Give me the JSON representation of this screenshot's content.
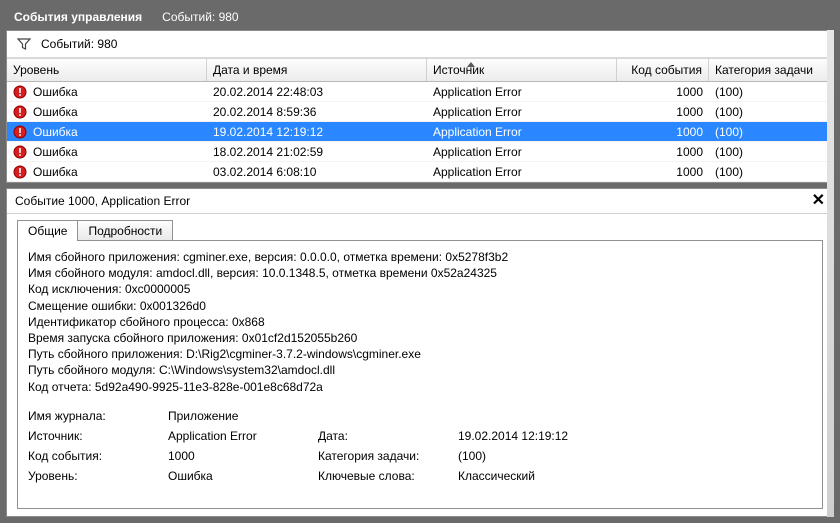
{
  "window": {
    "title": "События управления",
    "countLabel": "Событий: 980",
    "filterCount": "Событий: 980"
  },
  "columns": {
    "level": "Уровень",
    "datetime": "Дата и время",
    "source": "Источник",
    "code": "Код события",
    "category": "Категория задачи"
  },
  "rows": [
    {
      "level": "Ошибка",
      "dt": "20.02.2014 22:48:03",
      "src": "Application Error",
      "code": "1000",
      "cat": "(100)",
      "selected": false
    },
    {
      "level": "Ошибка",
      "dt": "20.02.2014 8:59:36",
      "src": "Application Error",
      "code": "1000",
      "cat": "(100)",
      "selected": false
    },
    {
      "level": "Ошибка",
      "dt": "19.02.2014 12:19:12",
      "src": "Application Error",
      "code": "1000",
      "cat": "(100)",
      "selected": true
    },
    {
      "level": "Ошибка",
      "dt": "18.02.2014 21:02:59",
      "src": "Application Error",
      "code": "1000",
      "cat": "(100)",
      "selected": false
    },
    {
      "level": "Ошибка",
      "dt": "03.02.2014 6:08:10",
      "src": "Application Error",
      "code": "1000",
      "cat": "(100)",
      "selected": false
    }
  ],
  "eventHeader": "Событие 1000, Application Error",
  "tabs": {
    "general": "Общие",
    "details": "Подробности"
  },
  "description": [
    "Имя сбойного приложения: cgminer.exe, версия: 0.0.0.0, отметка времени: 0x5278f3b2",
    "Имя сбойного модуля: amdocl.dll, версия: 10.0.1348.5, отметка времени 0x52a24325",
    "Код исключения: 0xc0000005",
    "Смещение ошибки: 0x001326d0",
    "Идентификатор сбойного процесса: 0x868",
    "Время запуска сбойного приложения: 0x01cf2d152055b260",
    "Путь сбойного приложения: D:\\Rig2\\cgminer-3.7.2-windows\\cgminer.exe",
    "Путь сбойного модуля: C:\\Windows\\system32\\amdocl.dll",
    "Код отчета: 5d92a490-9925-11e3-828e-001e8c68d72a"
  ],
  "meta": {
    "logNameLabel": "Имя журнала:",
    "logNameValue": "Приложение",
    "sourceLabel": "Источник:",
    "sourceValue": "Application Error",
    "dateLabel": "Дата:",
    "dateValue": "19.02.2014 12:19:12",
    "codeLabel": "Код события:",
    "codeValue": "1000",
    "catLabel": "Категория задачи:",
    "catValue": "(100)",
    "levelLabel": "Уровень:",
    "levelValue": "Ошибка",
    "keywordsLabel": "Ключевые слова:",
    "keywordsValue": "Классический"
  }
}
